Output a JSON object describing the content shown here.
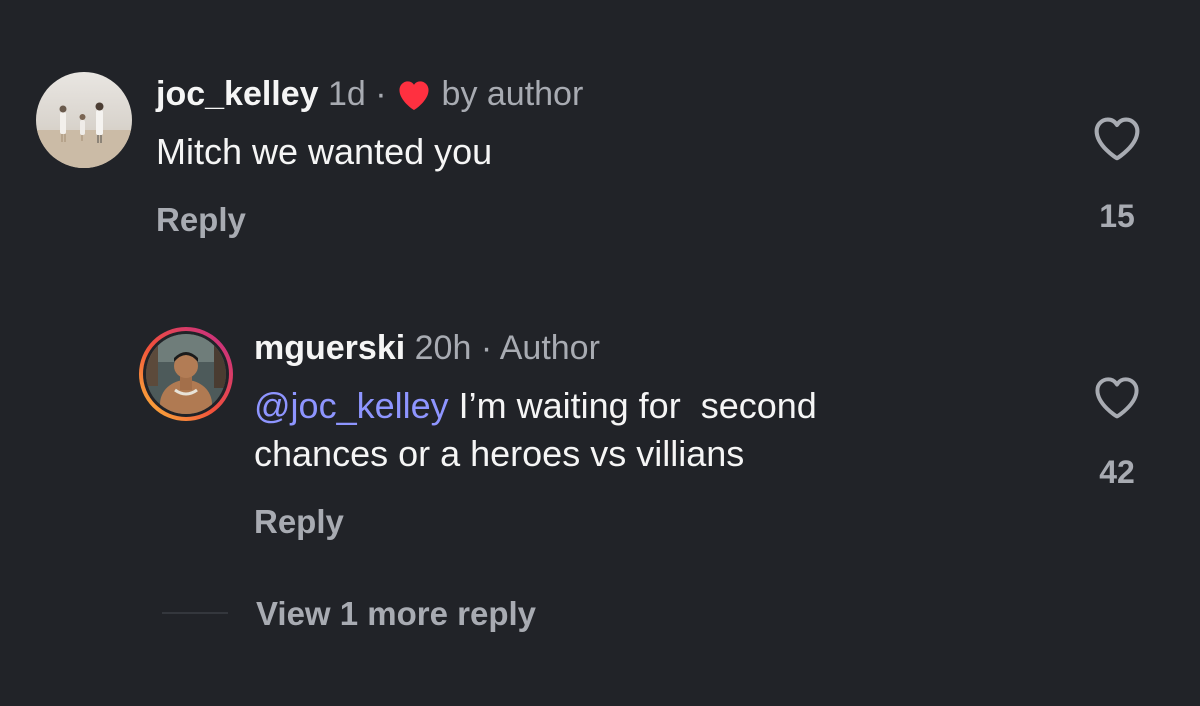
{
  "comments": [
    {
      "username": "joc_kelley",
      "time": "1d",
      "separator": "·",
      "badge_text": "by author",
      "badge_icon": "heart-filled-icon",
      "badge_color": "#ff3040",
      "body": "Mitch we wanted you",
      "reply_label": "Reply",
      "like_count": "15",
      "like_icon": "heart-outline-icon"
    },
    {
      "username": "mguerski",
      "time": "20h",
      "separator": "·",
      "badge_text": "Author",
      "mention": "@joc_kelley",
      "body_line1": " I’m waiting for  second",
      "body_line2": "chances or a heroes vs villians",
      "reply_label": "Reply",
      "like_count": "42",
      "like_icon": "heart-outline-icon"
    }
  ],
  "view_more_label": "View 1 more reply",
  "colors": {
    "background": "#212328",
    "muted_text": "#a8abb2",
    "mention": "#8e95ff",
    "liked_heart": "#ff3040"
  }
}
